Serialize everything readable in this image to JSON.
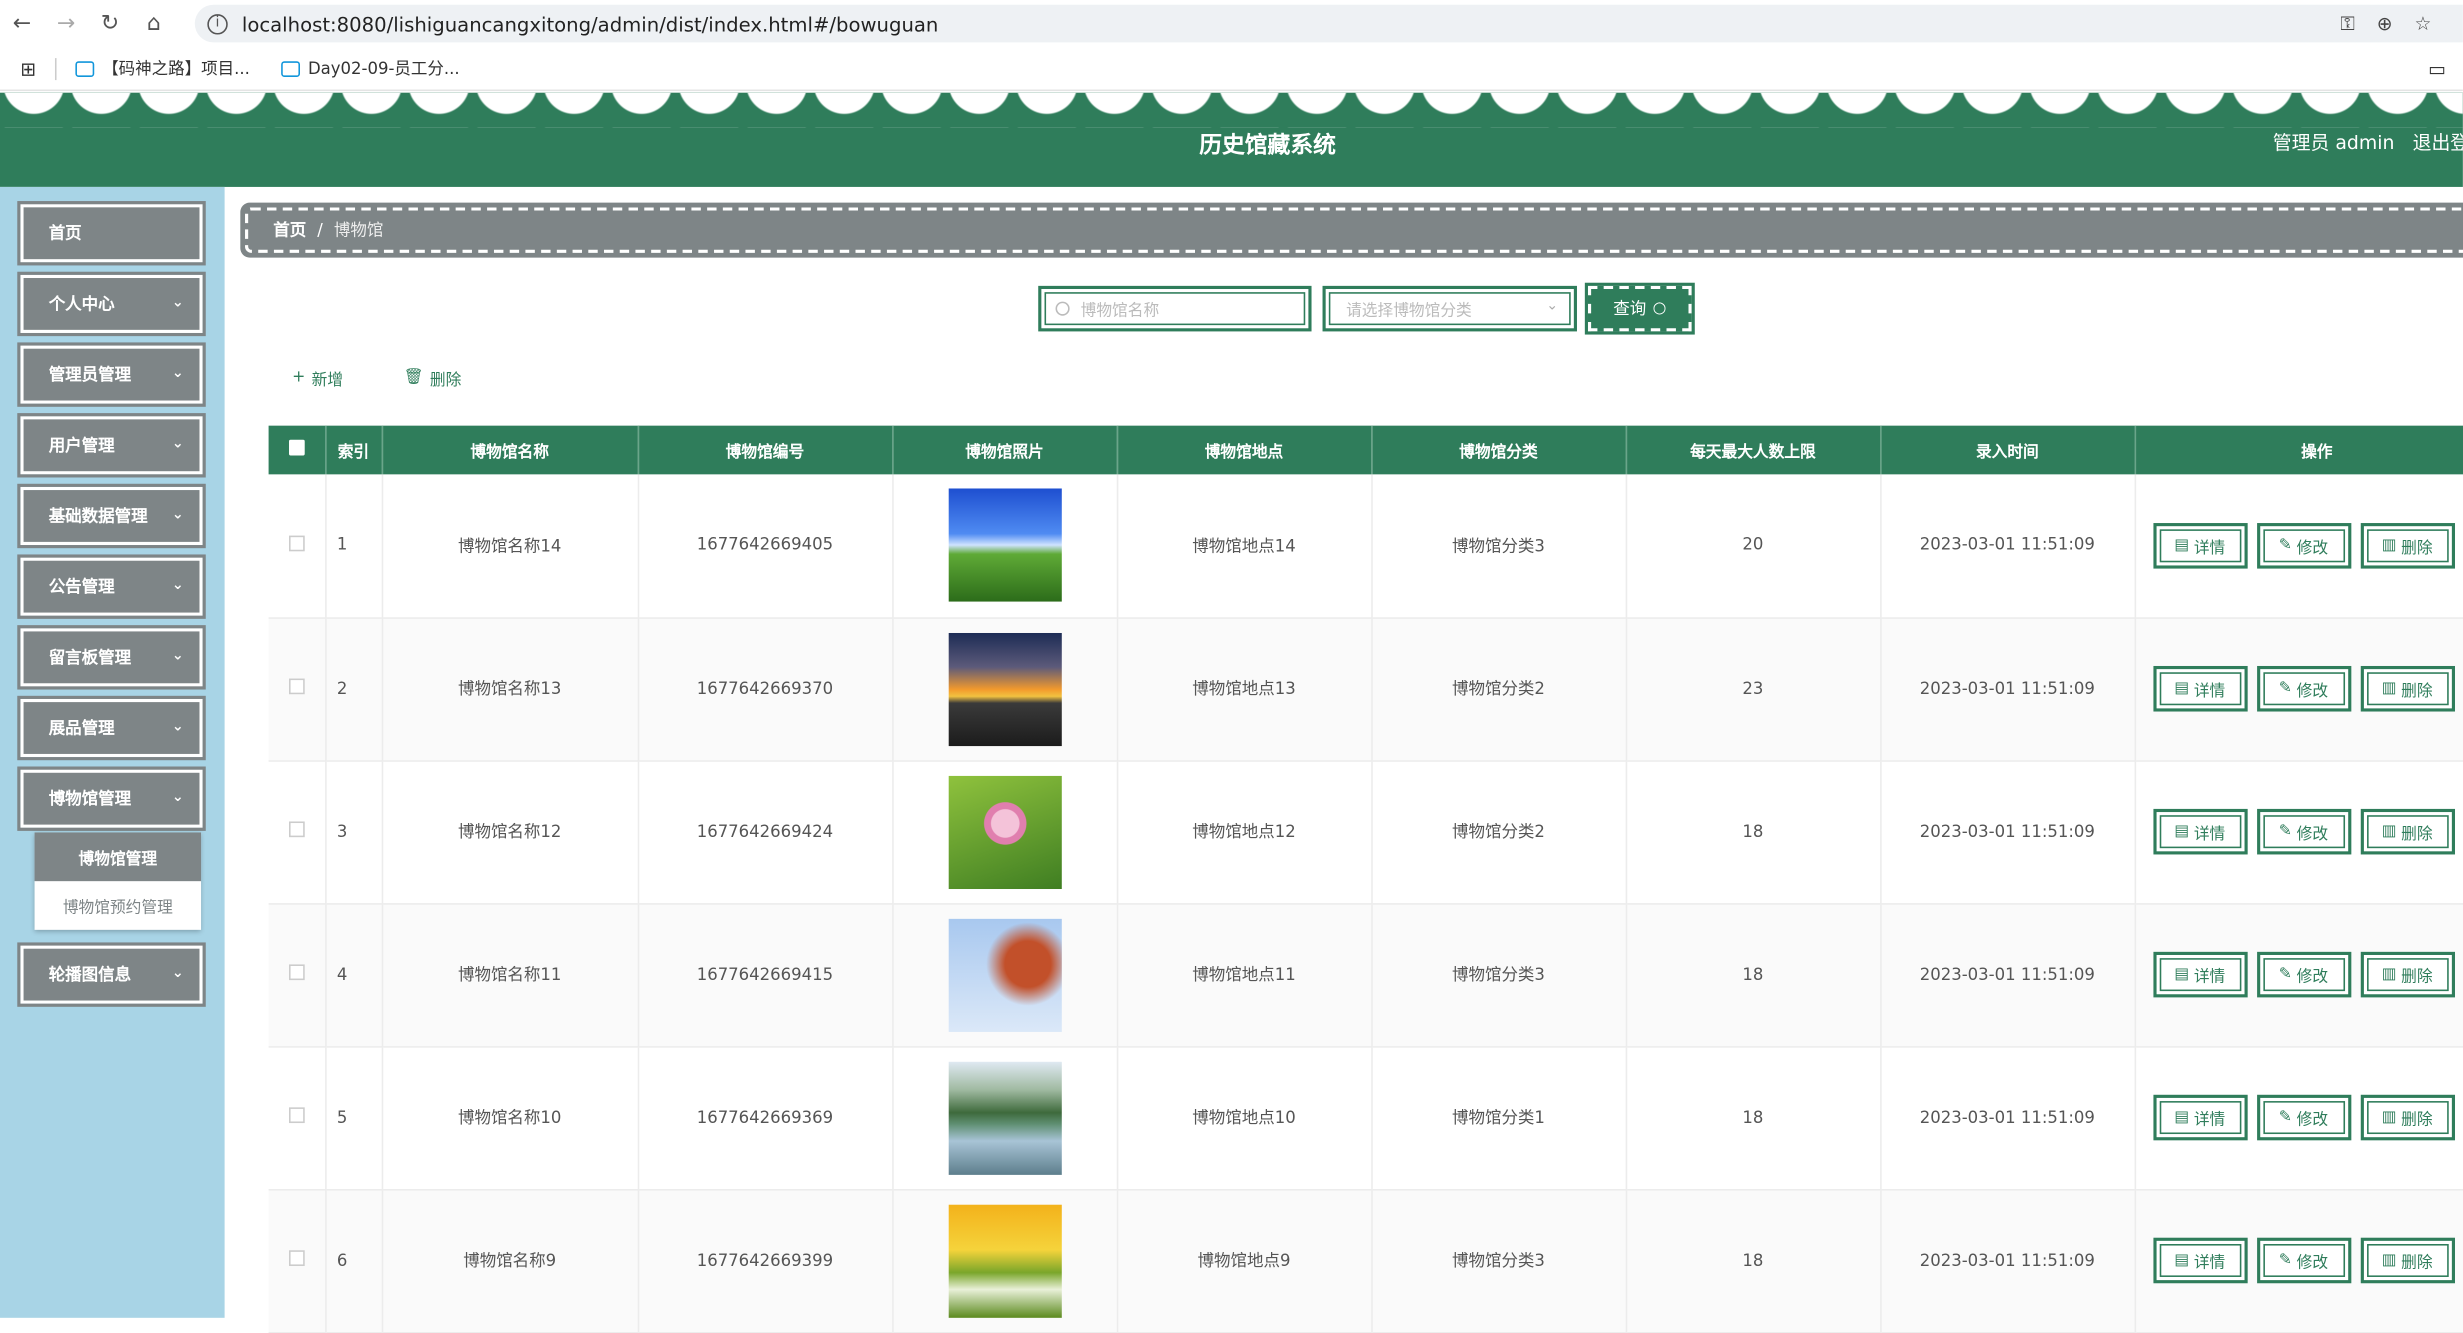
{
  "browser": {
    "url": "localhost:8080/lishiguancangxitong/admin/dist/index.html#/bowuguan",
    "bookmarks": [
      "【码神之路】项目...",
      "Day02-09-员工分..."
    ]
  },
  "header": {
    "title": "历史馆藏系统",
    "user": "管理员 admin",
    "logout": "退出登"
  },
  "sidebar": {
    "items": [
      {
        "label": "首页"
      },
      {
        "label": "个人中心"
      },
      {
        "label": "管理员管理"
      },
      {
        "label": "用户管理"
      },
      {
        "label": "基础数据管理"
      },
      {
        "label": "公告管理"
      },
      {
        "label": "留言板管理"
      },
      {
        "label": "展品管理"
      },
      {
        "label": "博物馆管理"
      },
      {
        "label": "轮播图信息"
      }
    ],
    "submenu": [
      "博物馆管理",
      "博物馆预约管理"
    ]
  },
  "breadcrumb": {
    "home": "首页",
    "sep": "/",
    "current": "博物馆"
  },
  "search": {
    "name_placeholder": "博物馆名称",
    "category_placeholder": "请选择博物馆分类",
    "button": "查询"
  },
  "actions": {
    "add": "新增",
    "delete": "删除"
  },
  "table": {
    "headers": [
      "索引",
      "博物馆名称",
      "博物馆编号",
      "博物馆照片",
      "博物馆地点",
      "博物馆分类",
      "每天最大人数上限",
      "录入时间",
      "操作"
    ],
    "ops": [
      "详情",
      "修改",
      "删除"
    ],
    "rows": [
      {
        "idx": "1",
        "name": "博物馆名称14",
        "code": "1677642669405",
        "photo": "sky-field",
        "place": "博物馆地点14",
        "cat": "博物馆分类3",
        "max": "20",
        "time": "2023-03-01 11:51:09"
      },
      {
        "idx": "2",
        "name": "博物馆名称13",
        "code": "1677642669370",
        "photo": "sunset-road",
        "place": "博物馆地点13",
        "cat": "博物馆分类2",
        "max": "23",
        "time": "2023-03-01 11:51:09"
      },
      {
        "idx": "3",
        "name": "博物馆名称12",
        "code": "1677642669424",
        "photo": "lotus",
        "place": "博物馆地点12",
        "cat": "博物馆分类2",
        "max": "18",
        "time": "2023-03-01 11:51:09"
      },
      {
        "idx": "4",
        "name": "博物馆名称11",
        "code": "1677642669415",
        "photo": "autumn-leaves",
        "place": "博物馆地点11",
        "cat": "博物馆分类3",
        "max": "18",
        "time": "2023-03-01 11:51:09"
      },
      {
        "idx": "5",
        "name": "博物馆名称10",
        "code": "1677642669369",
        "photo": "mountain-lake",
        "place": "博物馆地点10",
        "cat": "博物馆分类1",
        "max": "18",
        "time": "2023-03-01 11:51:09"
      },
      {
        "idx": "6",
        "name": "博物馆名称9",
        "code": "1677642669399",
        "photo": "flower-meadow",
        "place": "博物馆地点9",
        "cat": "博物馆分类3",
        "max": "18",
        "time": "2023-03-01 11:51:09"
      }
    ]
  },
  "colors": {
    "primary": "#2f7d5b",
    "menu": "#7e8587",
    "sidebar_bg": "#a8d4e6"
  }
}
